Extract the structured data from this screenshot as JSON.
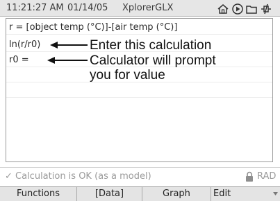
{
  "status_bar": {
    "time": "11:21:27 AM",
    "date": "01/14/05",
    "app_name": "XplorerGLX",
    "icons": [
      "home-icon",
      "play-icon",
      "folder-icon",
      "power-icon"
    ]
  },
  "calculator": {
    "lines": [
      "r = [object temp (°C)]-[air temp (°C)]",
      "ln(r/r0)",
      "r0 ="
    ],
    "annotations": [
      "Enter this calculation",
      "Calculator will prompt",
      "you for value"
    ]
  },
  "message_bar": {
    "message": "Calculation is OK (as a model)",
    "angle_mode": "RAD"
  },
  "softkeys": {
    "functions": "Functions",
    "data": "[Data]",
    "graph": "Graph",
    "edit": "Edit"
  },
  "colors": {
    "status_bar_bg": "#e6e6e6",
    "softkey_bg": "#e4e4e4",
    "message_text": "#9a9a9a"
  }
}
